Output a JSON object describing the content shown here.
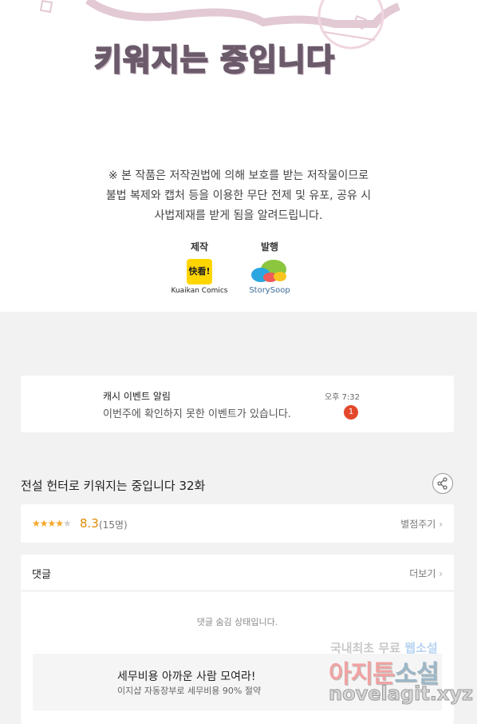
{
  "artwork": {
    "subtitle": "키워지는 중입니다"
  },
  "notice": {
    "line1": "※ 본 작품은 저작권법에 의해 보호를 받는 저작물이므로",
    "line2": "불법 복제와 캡처 등을 이용한 무단 전제 및 유포, 공유 시",
    "line3": "사법제재를 받게 됨을 알려드립니다."
  },
  "credits": {
    "production_label": "제작",
    "production_logo_text": "快看!",
    "production_name": "Kuaikan Comics",
    "publisher_label": "발행",
    "publisher_name": "StorySoop"
  },
  "notification": {
    "title": "캐시 이벤트 알림",
    "body": "이번주에 확인하지 못한 이벤트가 있습니다.",
    "time": "오후 7:32",
    "badge": "1"
  },
  "episode": {
    "title": "전설 헌터로 키워지는 중입니다 32화",
    "share_icon": "share-icon"
  },
  "rating": {
    "stars_on": "★★★★",
    "stars_off": "★",
    "score": "8.3",
    "count": "(15명)",
    "rate_link": "별점주기"
  },
  "comments": {
    "title": "댓글",
    "more_link": "더보기",
    "hidden_message": "댓글 숨김 상태입니다."
  },
  "ad": {
    "title": "세무비용 아까운 사람 모여라!",
    "description": "이지샵 자동장부로 세무비용 90% 절약"
  },
  "watermark": {
    "line1_a": "국내최초 무료",
    "line1_b": "웹소설",
    "big_a": "아지툰",
    "big_b": "소설",
    "url": "novelagit.xyz"
  },
  "colors": {
    "accent_star": "#f5a623",
    "badge": "#e4482c",
    "score": "#e08a00"
  }
}
